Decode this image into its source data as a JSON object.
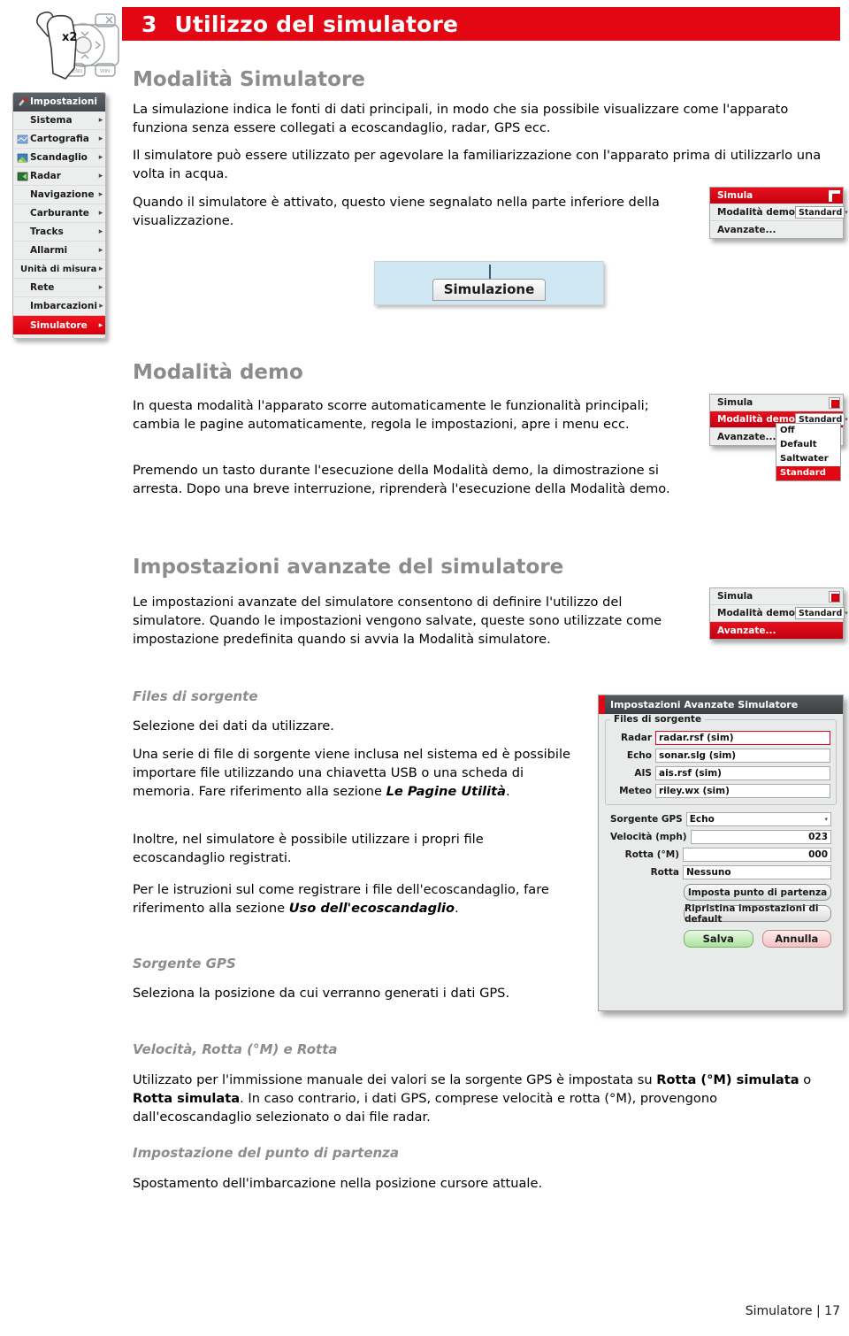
{
  "header": {
    "number": "3",
    "title": "Utilizzo del simulatore"
  },
  "hand_icon": {
    "label": "x2",
    "icon": "hand-press-twice-icon"
  },
  "menu": {
    "title": "Impostazioni",
    "items": [
      {
        "label": "Sistema",
        "arrow": "▸",
        "icon": ""
      },
      {
        "label": "Cartografia",
        "arrow": "▸",
        "icon": "chart-icon"
      },
      {
        "label": "Scandaglio",
        "arrow": "▸",
        "icon": "sonar-icon"
      },
      {
        "label": "Radar",
        "arrow": "▸",
        "icon": "radar-icon"
      },
      {
        "label": "Navigazione",
        "arrow": "▸",
        "icon": ""
      },
      {
        "label": "Carburante",
        "arrow": "▸",
        "icon": ""
      },
      {
        "label": "Tracks",
        "arrow": "▸",
        "icon": ""
      },
      {
        "label": "Allarmi",
        "arrow": "▸",
        "icon": ""
      },
      {
        "label": "Unità di misura",
        "arrow": "▸",
        "icon": ""
      },
      {
        "label": "Rete",
        "arrow": "▸",
        "icon": ""
      },
      {
        "label": "Imbarcazioni",
        "arrow": "▸",
        "icon": ""
      },
      {
        "label": "Simulatore",
        "arrow": "▸",
        "icon": "",
        "selected": true
      }
    ]
  },
  "sections": {
    "sim_mode": {
      "heading": "Modalità Simulatore",
      "p1": "La simulazione indica le fonti di dati principali, in modo che sia possibile visualizzare come l'apparato funziona senza essere collegati a ecoscandaglio, radar, GPS ecc.",
      "p2": "Il simulatore può essere utilizzato per agevolare la familiarizzazione con l'apparato prima di utilizzarlo una volta in acqua.",
      "p3": "Quando il simulatore è attivato, questo viene segnalato nella parte inferiore della visualizzazione."
    },
    "demo_mode": {
      "heading": "Modalità demo",
      "p1": "In questa modalità l'apparato scorre automaticamente le funzionalità principali; cambia le pagine automaticamente, regola le impostazioni, apre i menu ecc.",
      "p2": "Premendo un tasto durante l'esecuzione della Modalità demo, la dimostrazione si arresta. Dopo una breve interruzione, riprenderà l'esecuzione della Modalità demo."
    },
    "advanced": {
      "heading": "Impostazioni avanzate del simulatore",
      "p1": "Le impostazioni avanzate del simulatore consentono di definire l'utilizzo del simulatore. Quando le impostazioni vengono salvate, queste sono utilizzate come impostazione predefinita quando si avvia la Modalità simulatore."
    },
    "source_files": {
      "heading": "Files di sorgente",
      "p1": "Selezione dei dati da utilizzare.",
      "p2_a": "Una serie di file di sorgente viene inclusa nel sistema ed è possibile importare file utilizzando una chiavetta USB o una scheda di memoria. Fare riferimento alla sezione ",
      "p2_b": "Le Pagine Utilità",
      "p2_c": ".",
      "p3": "Inoltre, nel simulatore è possibile utilizzare i propri file ecoscandaglio registrati.",
      "p4_a": "Per le istruzioni sul come registrare i file dell'ecoscandaglio, fare riferimento alla sezione ",
      "p4_b": "Uso dell'ecoscandaglio",
      "p4_c": "."
    },
    "gps_source": {
      "heading": "Sorgente GPS",
      "p1": "Seleziona la posizione da cui verranno generati i dati GPS."
    },
    "speed_course": {
      "heading": "Velocità, Rotta (°M) e Rotta",
      "p1_a": "Utilizzato per l'immissione manuale dei valori se la sorgente GPS è impostata su ",
      "p1_b": "Rotta (°M) simulata",
      "p1_c": " o ",
      "p1_d": "Rotta simulata",
      "p1_e": ". In caso contrario, i dati GPS, comprese velocità e rotta (°M), provengono dall'ecoscandaglio selezionato o dai file radar."
    },
    "start_point": {
      "heading": "Impostazione del punto di partenza",
      "p1": "Spostamento dell'imbarcazione nella posizione cursore attuale."
    }
  },
  "sim_status_image": {
    "label": "Simulazione"
  },
  "sim_popup_1": {
    "row_simula": "Simula",
    "row_demo_label": "Modalità demo",
    "row_demo_value": "Standard",
    "row_advanced": "Avanzate...",
    "checked": true
  },
  "sim_popup_2": {
    "row_simula": "Simula",
    "row_demo_label": "Modalità demo",
    "row_demo_value": "Standard",
    "row_advanced": "Avanzate...",
    "dropdown_options": [
      "Off",
      "Default",
      "Saltwater",
      "Standard"
    ],
    "dropdown_selected": "Standard"
  },
  "sim_popup_3": {
    "row_simula": "Simula",
    "row_demo_label": "Modalità demo",
    "row_demo_value": "Standard",
    "row_advanced": "Avanzate..."
  },
  "advanced_panel": {
    "title": "Impostazioni Avanzate Simulatore",
    "group_legend": "Files di sorgente",
    "fields": [
      {
        "label": "Radar",
        "value": "radar.rsf (sim)"
      },
      {
        "label": "Echo",
        "value": "sonar.slg (sim)"
      },
      {
        "label": "AIS",
        "value": "ais.rsf (sim)"
      },
      {
        "label": "Meteo",
        "value": "riley.wx (sim)"
      }
    ],
    "gps_source_label": "Sorgente GPS",
    "gps_source_value": "Echo",
    "speed_label": "Velocità (mph)",
    "speed_value": "023",
    "course_label": "Rotta (°M)",
    "course_value": "000",
    "route_label": "Rotta",
    "route_value": "Nessuno",
    "btn_start_point": "Imposta punto di partenza",
    "btn_restore": "Ripristina impostazioni di default",
    "btn_save": "Salva",
    "btn_cancel": "Annulla"
  },
  "footer": {
    "text": "Simulatore | 17"
  },
  "colors": {
    "accent_red": "#e30613",
    "heading_gray": "#8c8c8c",
    "status_blue": "#cfe7f2"
  }
}
